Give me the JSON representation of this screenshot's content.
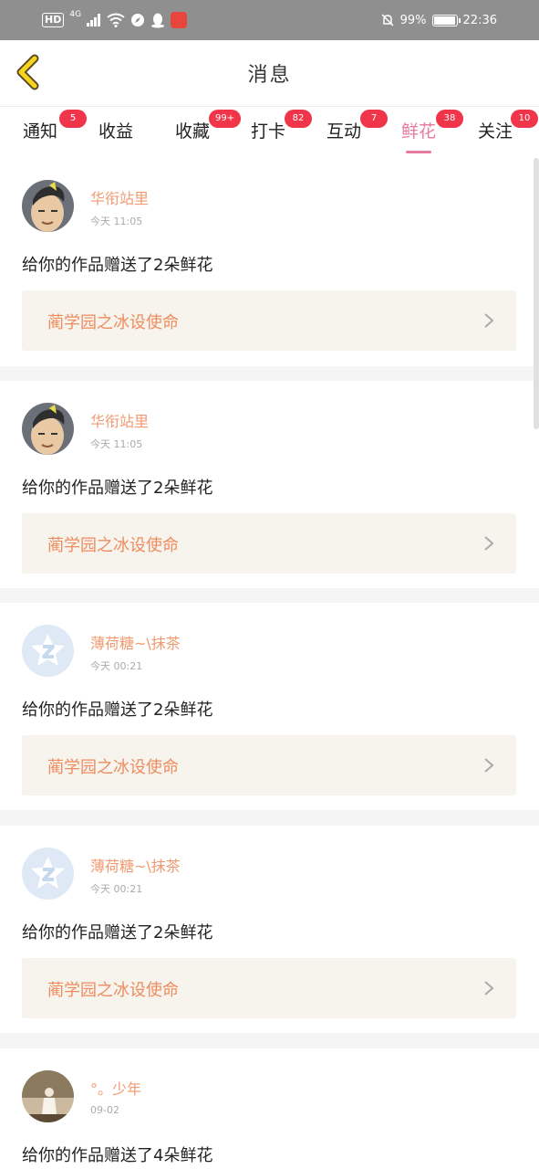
{
  "status_bar": {
    "hd": "HD",
    "network": "4G",
    "battery_percent": "99%",
    "battery_level": 0.99,
    "time": "22:36",
    "icons": [
      "signal-icon",
      "wifi-icon",
      "compass-icon",
      "qq-icon",
      "app-icon",
      "bell-muted-icon",
      "battery-icon"
    ]
  },
  "header": {
    "title": "消息",
    "back_icon": "chevron-left-icon"
  },
  "tabs": [
    {
      "label": "通知",
      "badge": "5"
    },
    {
      "label": "收益",
      "badge": ""
    },
    {
      "label": "收藏",
      "badge": "99+"
    },
    {
      "label": "打卡",
      "badge": "82"
    },
    {
      "label": "互动",
      "badge": "7"
    },
    {
      "label": "鲜花",
      "badge": "38",
      "active": true
    },
    {
      "label": "关注",
      "badge": "10"
    }
  ],
  "messages": [
    {
      "user": "华衔站里",
      "time": "今天 11:05",
      "text": "给你的作品赠送了2朵鲜花",
      "work": "蔺学园之冰设使命",
      "avatar": "cartoon-man-avatar"
    },
    {
      "user": "华衔站里",
      "time": "今天 11:05",
      "text": "给你的作品赠送了2朵鲜花",
      "work": "蔺学园之冰设使命",
      "avatar": "cartoon-man-avatar"
    },
    {
      "user": "薄荷糖~\\抹茶",
      "time": "今天 00:21",
      "text": "给你的作品赠送了2朵鲜花",
      "work": "蔺学园之冰设使命",
      "avatar": "qq-default-avatar"
    },
    {
      "user": "薄荷糖~\\抹茶",
      "time": "今天 00:21",
      "text": "给你的作品赠送了2朵鲜花",
      "work": "蔺学园之冰设使命",
      "avatar": "qq-default-avatar"
    },
    {
      "user": "°。少年",
      "time": "09-02",
      "text": "给你的作品赠送了4朵鲜花",
      "work": "",
      "avatar": "photo-avatar"
    }
  ],
  "colors": {
    "status_bar": "#8f8f8f",
    "accent_pink": "#e87aa0",
    "badge_red": "#f0344a",
    "username_orange": "#f19a72",
    "work_orange": "#ee8c60",
    "work_bg": "#f6f4ec",
    "back_arrow_yellow": "#f7d51d"
  }
}
